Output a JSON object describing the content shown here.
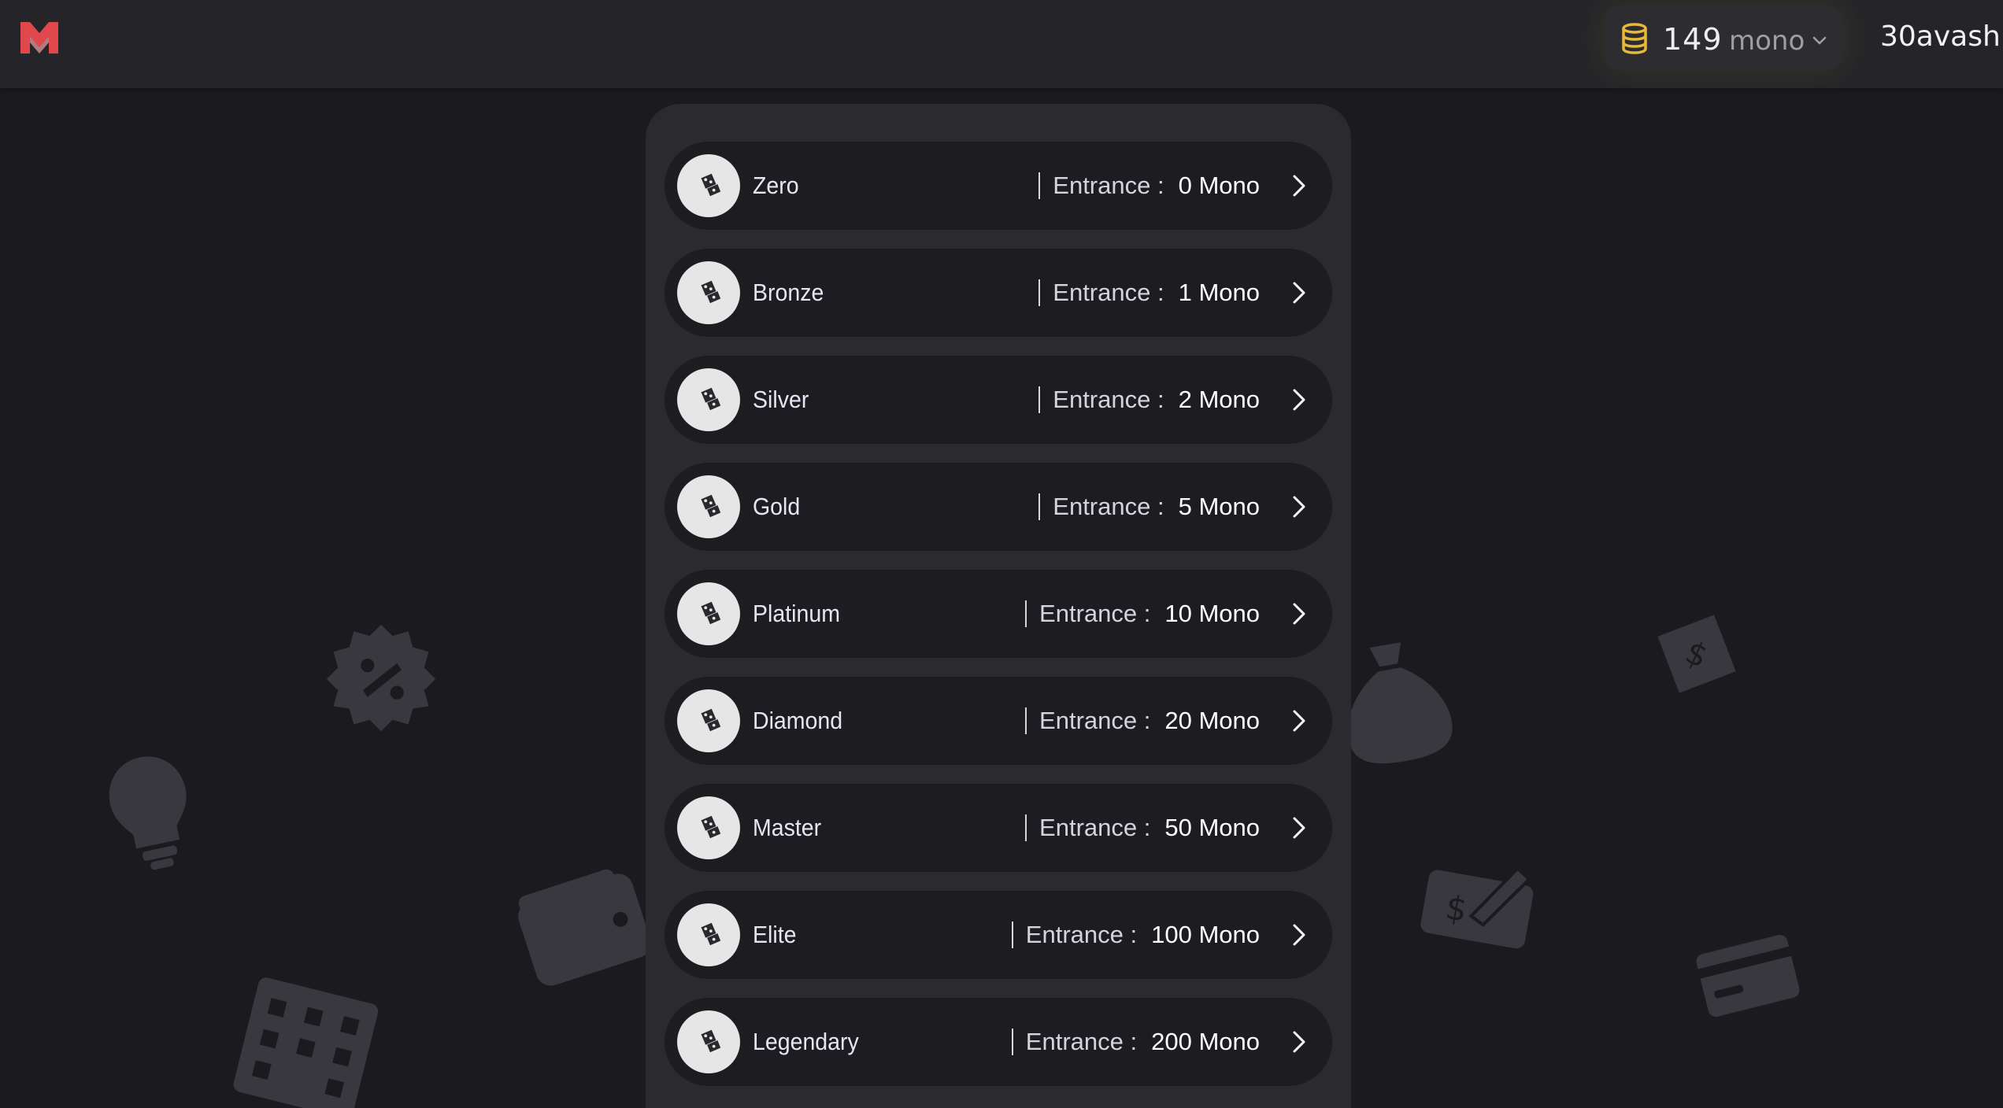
{
  "header": {
    "wallet": {
      "amount": "149",
      "currency": "mono"
    },
    "username": "30avash"
  },
  "rooms": [
    {
      "name": "Zero",
      "entrance_label": "Entrance :",
      "entrance_value": "0 Mono"
    },
    {
      "name": "Bronze",
      "entrance_label": "Entrance :",
      "entrance_value": "1 Mono"
    },
    {
      "name": "Silver",
      "entrance_label": "Entrance :",
      "entrance_value": "2 Mono"
    },
    {
      "name": "Gold",
      "entrance_label": "Entrance :",
      "entrance_value": "5 Mono"
    },
    {
      "name": "Platinum",
      "entrance_label": "Entrance :",
      "entrance_value": "10 Mono"
    },
    {
      "name": "Diamond",
      "entrance_label": "Entrance :",
      "entrance_value": "20 Mono"
    },
    {
      "name": "Master",
      "entrance_label": "Entrance :",
      "entrance_value": "50 Mono"
    },
    {
      "name": "Elite",
      "entrance_label": "Entrance :",
      "entrance_value": "100 Mono"
    },
    {
      "name": "Legendary",
      "entrance_label": "Entrance :",
      "entrance_value": "200 Mono"
    }
  ],
  "icons": {
    "logo": "brand-logo-icon",
    "coin": "coin-stack-icon",
    "chevron": "chevron-down-icon",
    "room": "dice-icon",
    "arrow": "chevron-right-icon"
  },
  "colors": {
    "background": "#1b1b1f",
    "topbar": "#252529",
    "panel": "#2c2c30",
    "row": "#1d1d21",
    "coin": "#e6b93a",
    "logo": "#e0484e"
  }
}
